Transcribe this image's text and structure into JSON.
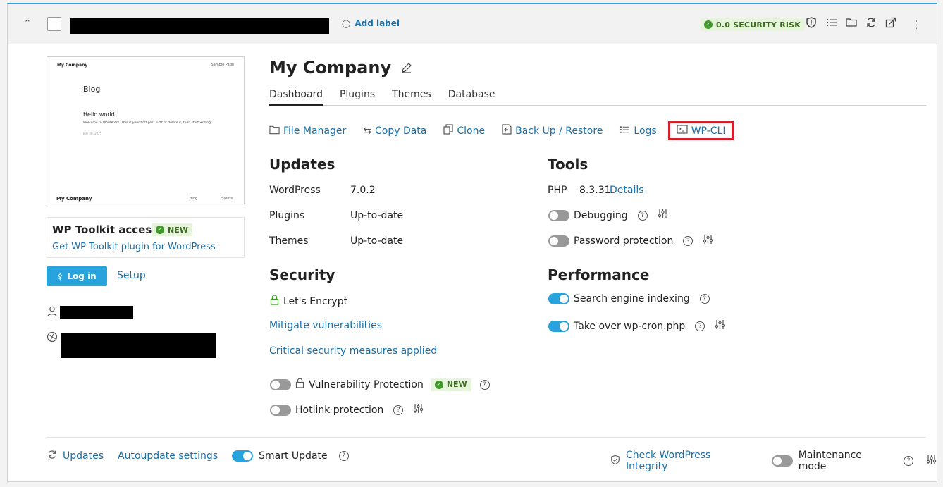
{
  "header": {
    "add_label": "Add label",
    "security_risk": "0.0 SECURITY RISK"
  },
  "thumbnail": {
    "company": "My Company",
    "sample_page": "Sample Page",
    "blog": "Blog",
    "hello": "Hello world!",
    "welcome": "Welcome to WordPress. This is your first post. Edit or delete it, then start writing!",
    "date": "July 28, 2025",
    "footer_company": "My Company",
    "footer_blog": "Blog",
    "footer_events": "Events"
  },
  "toolkit": {
    "title": "WP Toolkit access",
    "badge": "NEW",
    "link": "Get WP Toolkit plugin for WordPress"
  },
  "login": {
    "login_label": "Log in",
    "setup_label": "Setup"
  },
  "site": {
    "title": "My Company",
    "tabs": [
      "Dashboard",
      "Plugins",
      "Themes",
      "Database"
    ],
    "actions": [
      "File Manager",
      "Copy Data",
      "Clone",
      "Back Up / Restore",
      "Logs",
      "WP-CLI"
    ]
  },
  "updates": {
    "heading": "Updates",
    "rows": [
      {
        "label": "WordPress",
        "value": "7.0.2"
      },
      {
        "label": "Plugins",
        "value": "Up-to-date"
      },
      {
        "label": "Themes",
        "value": "Up-to-date"
      }
    ]
  },
  "security": {
    "heading": "Security",
    "encrypt": "Let's Encrypt",
    "mitigate": "Mitigate vulnerabilities",
    "critical": "Critical security measures applied",
    "vuln_protection": "Vulnerability Protection",
    "vuln_badge": "NEW",
    "hotlink": "Hotlink protection"
  },
  "tools": {
    "heading": "Tools",
    "php_label": "PHP",
    "php_version": "8.3.31",
    "details": "Details",
    "debugging": "Debugging",
    "password": "Password protection"
  },
  "performance": {
    "heading": "Performance",
    "indexing": "Search engine indexing",
    "cron": "Take over wp-cron.php"
  },
  "footer": {
    "updates": "Updates",
    "autoupdate": "Autoupdate settings",
    "smart_update": "Smart Update",
    "integrity": "Check WordPress Integrity",
    "maintenance": "Maintenance mode"
  }
}
